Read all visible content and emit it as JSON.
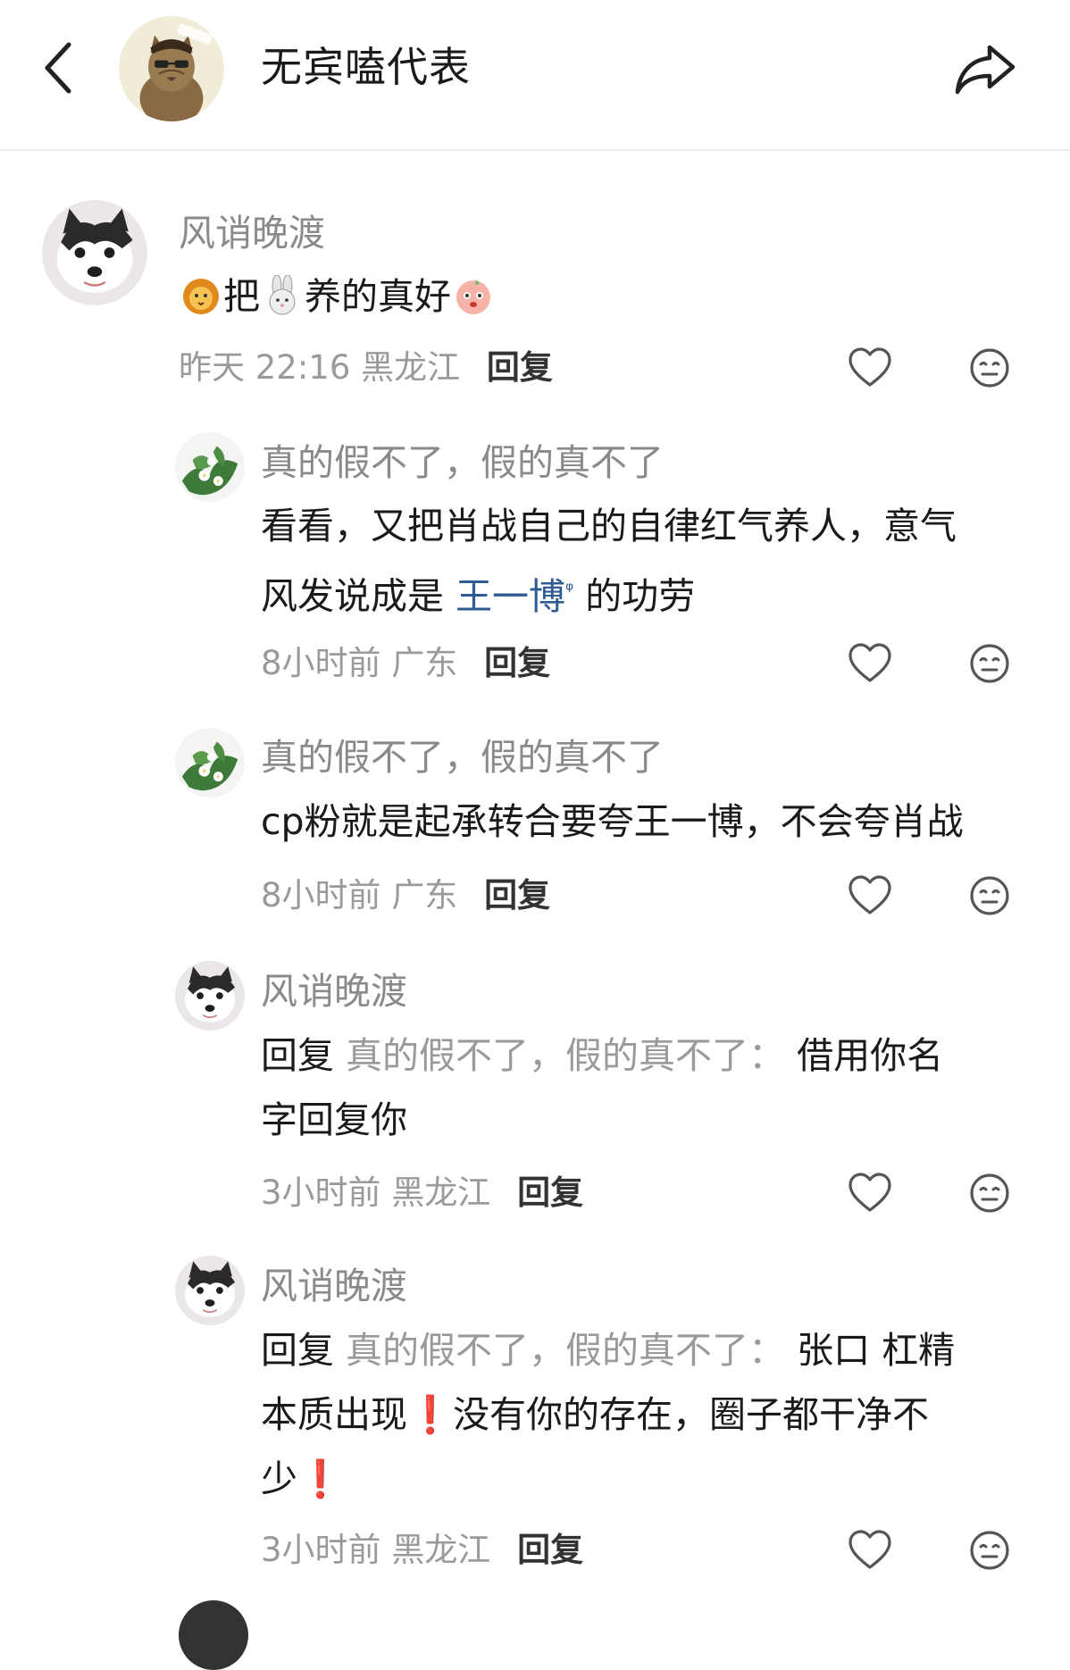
{
  "header": {
    "title": "无宾嗑代表",
    "avatar_badge": "无宾嗑代表"
  },
  "comments": [
    {
      "user": "风诮晚渡",
      "reply_prefix": "",
      "reply_to": "",
      "lines": [
        "把",
        "养的真好"
      ],
      "emojis": [
        "lion-emoji",
        "rabbit-emoji",
        "blushing-face-emoji"
      ],
      "time": "昨天 22:16",
      "location": "黑龙江",
      "reply_label": "回复"
    },
    {
      "user": "真的假不了，假的真不了",
      "lines": [
        "看看，又把肖战自己的自律红气养人，意气",
        "风发说成是",
        "王一博",
        "的功劳"
      ],
      "link_icon": "ᵠ",
      "time": "8小时前",
      "location": "广东",
      "reply_label": "回复"
    },
    {
      "user": "真的假不了，假的真不了",
      "lines": [
        "cp粉就是起承转合要夸王一博，不会夸肖战"
      ],
      "time": "8小时前",
      "location": "广东",
      "reply_label": "回复"
    },
    {
      "user": "风诮晚渡",
      "reply_prefix": "回复",
      "reply_to": "真的假不了，假的真不了：",
      "lines": [
        "借用你名",
        "字回复你"
      ],
      "time": "3小时前",
      "location": "黑龙江",
      "reply_label": "回复"
    },
    {
      "user": "风诮晚渡",
      "reply_prefix": "回复",
      "reply_to": "真的假不了，假的真不了：",
      "lines": [
        "张口 杠精",
        "本质出现",
        "没有你的存在，圈子都干净不",
        "少"
      ],
      "exclaim": "❗",
      "time": "3小时前",
      "location": "黑龙江",
      "reply_label": "回复"
    }
  ],
  "colors": {
    "username": "#8a8a8a",
    "meta": "#9a9a9a",
    "link": "#2f5b93",
    "exclaim": "#e0302b"
  },
  "icons": [
    "back-arrow-icon",
    "share-icon",
    "heart-icon",
    "dislike-face-icon"
  ]
}
